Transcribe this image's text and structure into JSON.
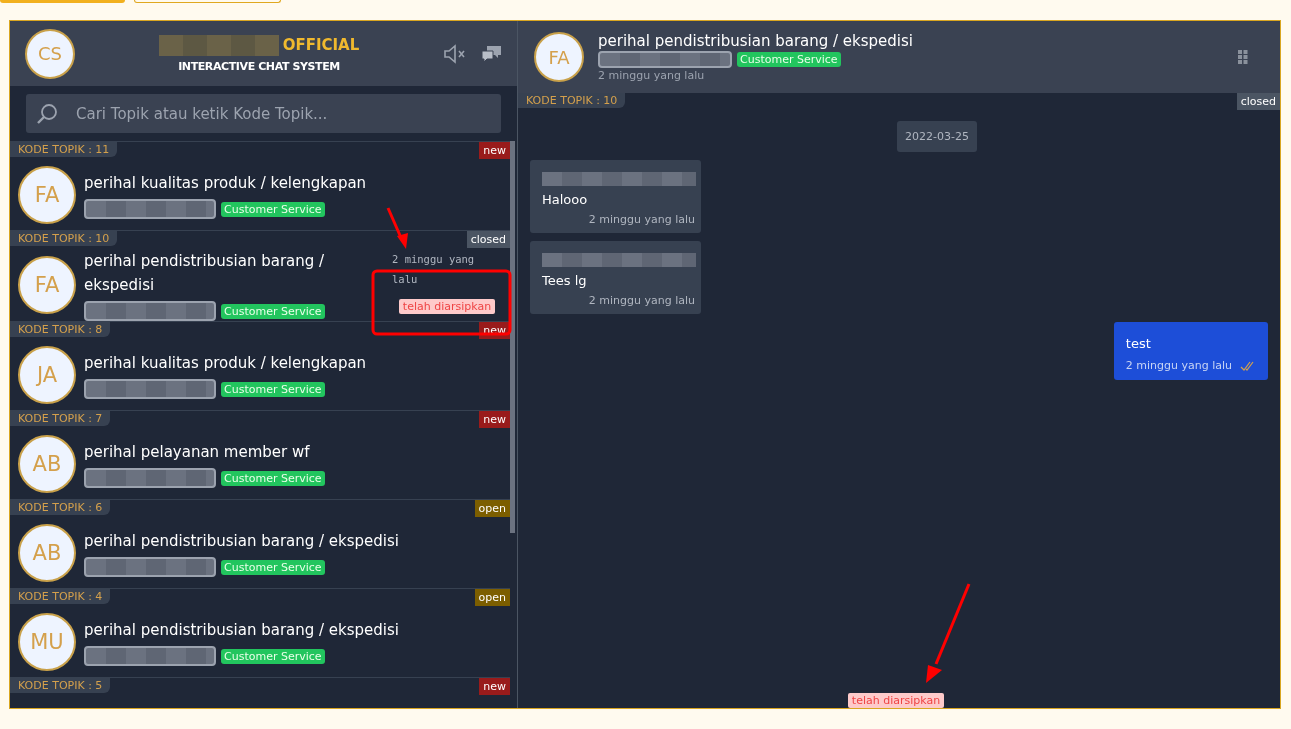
{
  "header": {
    "avatar": "CS",
    "brand": "OFFICIAL",
    "subtitle": "INTERACTIVE CHAT SYSTEM"
  },
  "search": {
    "placeholder": "Cari Topik atau ketik Kode Topik..."
  },
  "topics": [
    {
      "code": "KODE TOPIK : 11",
      "status": "new",
      "kind": "new",
      "avatar": "FA",
      "title": "perihal kualitas produk / kelengkapan",
      "tag": "Customer Service"
    },
    {
      "code": "KODE TOPIK : 10",
      "status": "closed",
      "kind": "closed",
      "avatar": "FA",
      "title": "perihal pendistribusian barang / ekspedisi",
      "tag": "Customer Service",
      "time": "2 minggu yang lalu",
      "archived_label": "telah diarsipkan"
    },
    {
      "code": "KODE TOPIK : 8",
      "status": "new",
      "kind": "new",
      "avatar": "JA",
      "title": "perihal kualitas produk / kelengkapan",
      "tag": "Customer Service"
    },
    {
      "code": "KODE TOPIK : 7",
      "status": "new",
      "kind": "new",
      "avatar": "AB",
      "title": "perihal pelayanan member wf",
      "tag": "Customer Service"
    },
    {
      "code": "KODE TOPIK : 6",
      "status": "open",
      "kind": "open",
      "avatar": "AB",
      "title": "perihal pendistribusian barang / ekspedisi",
      "tag": "Customer Service"
    },
    {
      "code": "KODE TOPIK : 4",
      "status": "open",
      "kind": "open",
      "avatar": "MU",
      "title": "perihal pendistribusian barang / ekspedisi",
      "tag": "Customer Service"
    },
    {
      "code": "KODE TOPIK : 5",
      "status": "new",
      "kind": "new"
    }
  ],
  "chat": {
    "avatar": "FA",
    "title": "perihal pendistribusian barang / ekspedisi",
    "tag": "Customer Service",
    "time": "2 minggu yang lalu",
    "code": "KODE TOPIK : 10",
    "status": "closed",
    "kind": "closed",
    "date": "2022-03-25",
    "messages": [
      {
        "kind": "incoming",
        "text": "Halooo",
        "time": "2 minggu yang lalu"
      },
      {
        "kind": "incoming",
        "text": "Tees lg",
        "time": "2 minggu yang lalu"
      },
      {
        "kind": "outgoing",
        "text": "test",
        "time": "2 minggu yang lalu",
        "read": true
      }
    ],
    "archived_label": "telah diarsipkan"
  }
}
